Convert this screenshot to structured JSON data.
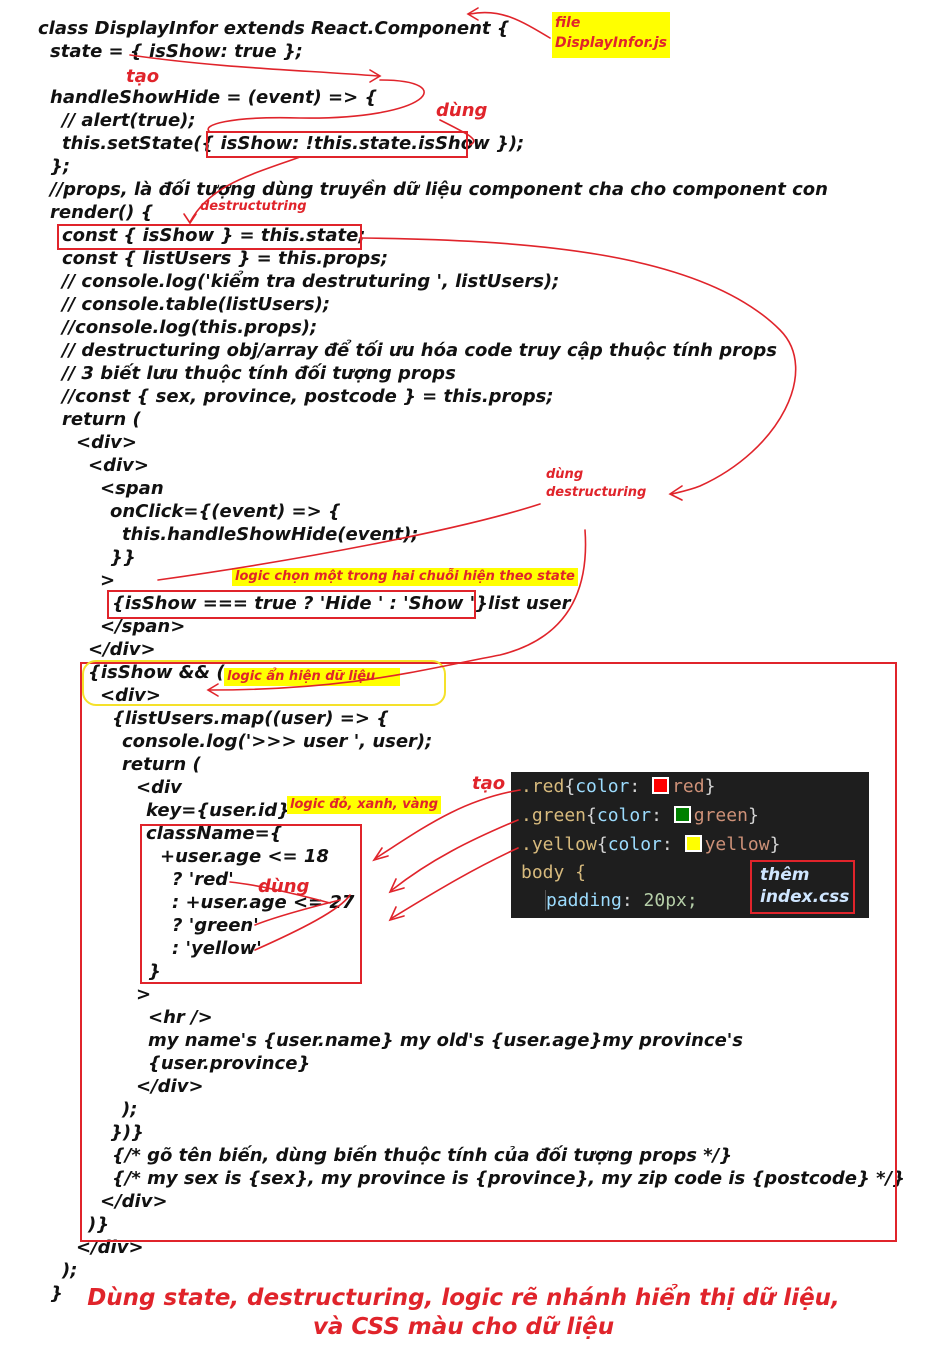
{
  "code_lines": [
    "class DisplayInfor extends React.Component {",
    "state = { isShow: true };",
    "handleShowHide = (event) => {",
    "// alert(true);",
    "this.setState({ isShow: !this.state.isShow });",
    "};",
    "//props, là đối tượng dùng truyền dữ liệu component cha cho component con",
    "render() {",
    "const { isShow } = this.state;",
    "const { listUsers } = this.props;",
    "// console.log('kiểm tra destruturing ', listUsers);",
    "// console.table(listUsers);",
    "//console.log(this.props);",
    "// destructuring obj/array để tối ưu hóa code truy cập thuộc tính props",
    "// 3 biết lưu thuộc tính đối tượng props",
    "//const { sex, province, postcode } = this.props;",
    "return (",
    "<div>",
    "<div>",
    "<span",
    "onClick={(event) => {",
    "this.handleShowHide(event);",
    "}}",
    ">",
    "{isShow === true ? 'Hide ' : 'Show '}list user",
    "</span>",
    "</div>",
    "{isShow && (",
    "<div>",
    "{listUsers.map((user) => {",
    "console.log('>>> user ', user);",
    "return (",
    "<div",
    "key={user.id}",
    "className={",
    "+user.age <= 18",
    "? 'red'",
    ": +user.age <= 27",
    "? 'green'",
    ": 'yellow'",
    "}",
    ">",
    "<hr />",
    "my name's {user.name} my old's {user.age}my province's",
    "{user.province}",
    "</div>",
    ");",
    "})}",
    "{/* gõ tên biến, dùng biến thuộc tính của đối tượng props */}",
    "{/* my sex is {sex}, my province is {province}, my zip code is {postcode} */}",
    "</div>",
    ")}",
    "</div>",
    ");",
    "}"
  ],
  "annotations": {
    "file_note": "file\nDisplayInfor.js",
    "tao_1": "tạo",
    "dung_1": "dùng",
    "destructutring": "destructutring",
    "dung_destructuring": "dùng\ndestructuring",
    "logic_choose": "logic chọn một trong hai chuỗi hiện theo state",
    "logic_show_hide": "logic ẩn hiện dữ liệu",
    "logic_colors": "logic đỏ, xanh, vàng",
    "tao_2": "tạo",
    "dung_2": "dùng"
  },
  "css_panel": {
    "lines": [
      {
        "selector": ".red",
        "prop": "color",
        "value": "red",
        "swatch": "#ff0000"
      },
      {
        "selector": ".green",
        "prop": "color",
        "value": "green",
        "swatch": "#008000"
      },
      {
        "selector": ".yellow",
        "prop": "color",
        "value": "yellow",
        "swatch": "#ffff00"
      }
    ],
    "body_selector": "body {",
    "padding_prop": "padding",
    "padding_value": "20px;",
    "them_label": "thêm\nindex.css"
  },
  "footer": {
    "line1": "Dùng state, destructuring, logic rẽ nhánh hiển thị dữ liệu,",
    "line2": "và CSS màu cho dữ liệu"
  },
  "colors": {
    "annotation_red": "#e0242b",
    "highlight_yellow": "#ffff00",
    "panel_bg": "#1e1e1e"
  }
}
